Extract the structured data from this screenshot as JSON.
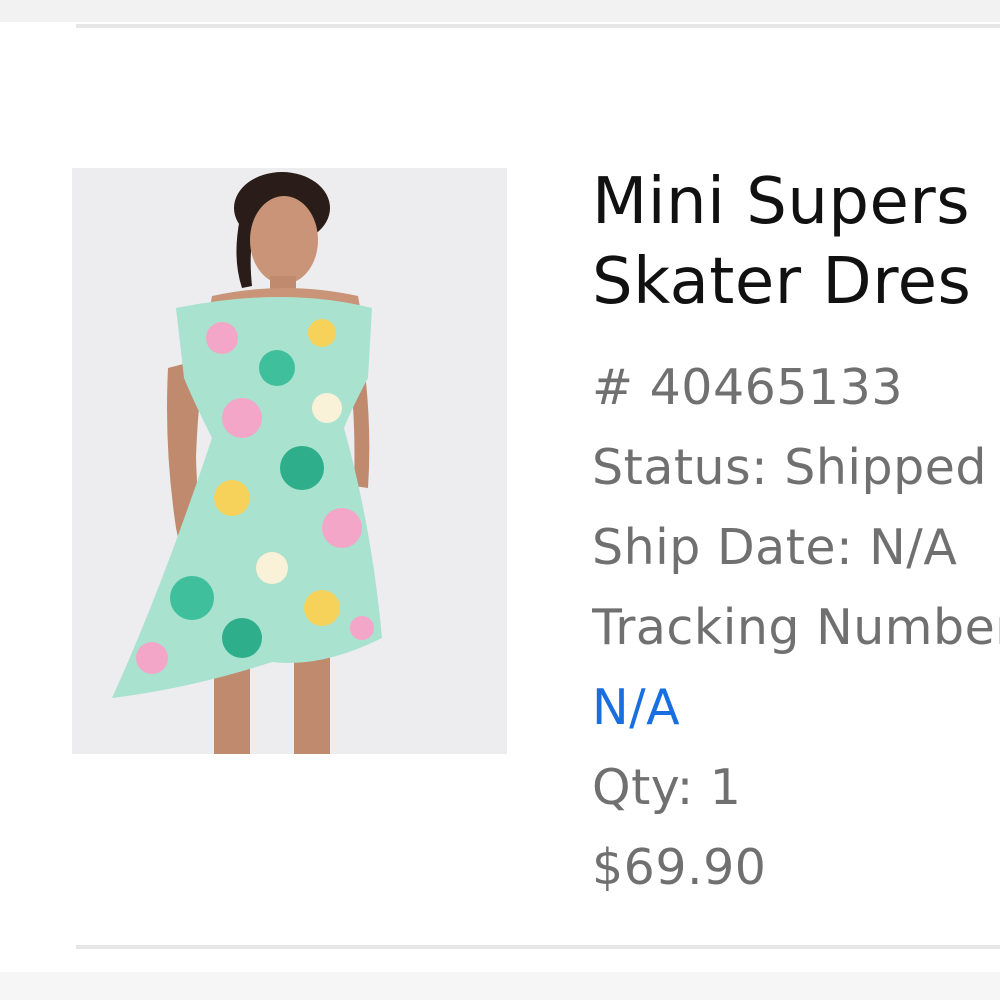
{
  "product": {
    "image_alt": "Floral off-shoulder skater dress",
    "title_line1": "Mini Supers",
    "title_line2": "Skater Dres",
    "number": "# 40465133",
    "status": "Status: Shipped",
    "ship_date": "Ship Date: N/A",
    "tracking_label": "Tracking Number:",
    "tracking_value": "N/A",
    "qty": "Qty: 1",
    "price": "$69.90"
  },
  "colors": {
    "title": "#111111",
    "meta_text": "#707070",
    "link": "#1a6fe0",
    "image_background": "#ededf0",
    "divider": "#e6e6e6"
  }
}
